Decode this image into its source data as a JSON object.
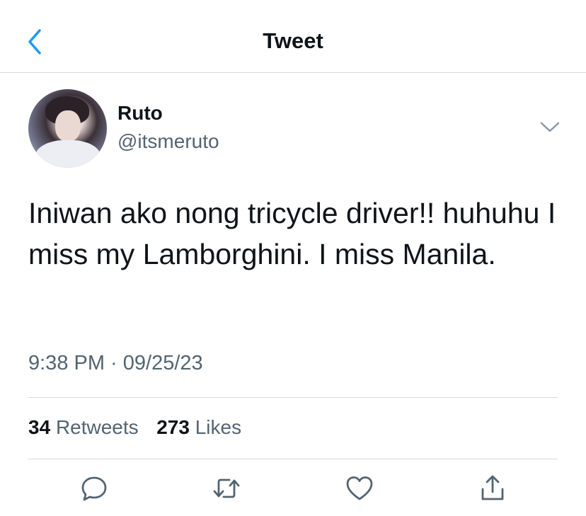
{
  "header": {
    "title": "Tweet",
    "back_icon": "chevron-left-icon",
    "accent_color": "#1d9bf0"
  },
  "tweet": {
    "author_name": "Ruto",
    "author_handle": "@itsmeruto",
    "text": "Iniwan ako nong tricycle driver!! huhuhu I miss my Lamborghini. I miss Manila.",
    "time": "9:38 PM",
    "separator": " · ",
    "date": "09/25/23",
    "retweet_count": "34",
    "retweets_label": "Retweets",
    "like_count": "273",
    "likes_label": "Likes"
  },
  "actions": [
    {
      "icon": "reply-icon"
    },
    {
      "icon": "retweet-icon"
    },
    {
      "icon": "like-icon"
    },
    {
      "icon": "share-icon"
    }
  ],
  "colors": {
    "text": "#0f1419",
    "secondary": "#536471",
    "divider": "#d4d9de",
    "icon": "#536471"
  }
}
